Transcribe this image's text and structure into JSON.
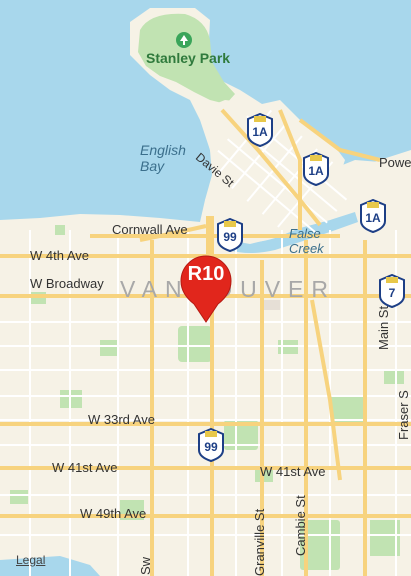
{
  "map": {
    "city_label": "VANCOUVER",
    "water_labels": [
      "English Bay",
      "False Creek"
    ],
    "park_labels": [
      "Stanley Park"
    ],
    "street_labels": [
      "Davie St",
      "Powel",
      "Cornwall Ave",
      "W 4th Ave",
      "W Broadway",
      "Main St",
      "Fraser S",
      "W 33rd Ave",
      "W 41st Ave",
      "W 41st Ave",
      "W 49th Ave",
      "Cambie St",
      "Granville St",
      "Sw"
    ],
    "highway_shields": [
      "1A",
      "1A",
      "1A",
      "99",
      "7",
      "99"
    ],
    "selected_marker": "R10",
    "legal_link": "Legal"
  },
  "colors": {
    "water": "#a8d7ec",
    "land": "#f6f2e6",
    "park": "#c1e3b2",
    "road_major": "#f7d37e",
    "marker": "#e1261c",
    "shield_blue": "#1d3f86"
  },
  "icons": {
    "park": "tree-icon",
    "marker": "map-pin-icon"
  }
}
